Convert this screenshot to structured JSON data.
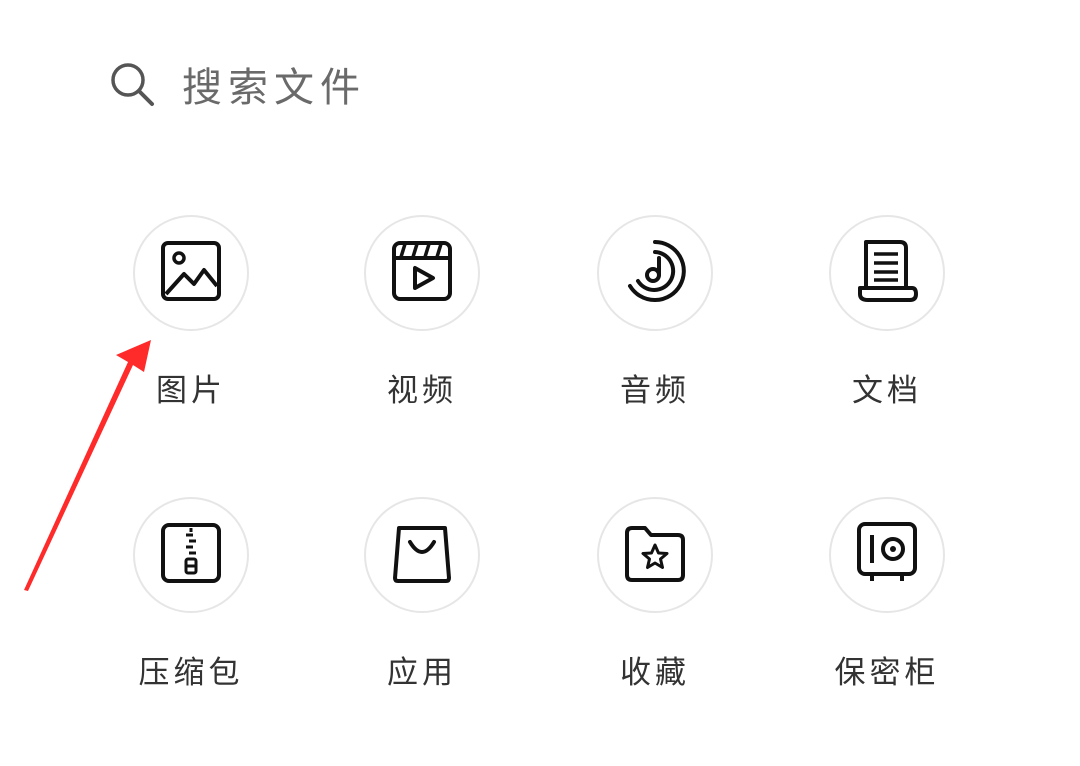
{
  "search": {
    "placeholder": "搜索文件",
    "icon": "search-icon"
  },
  "categories": [
    {
      "label": "图片",
      "icon": "image-icon"
    },
    {
      "label": "视频",
      "icon": "video-icon"
    },
    {
      "label": "音频",
      "icon": "audio-icon"
    },
    {
      "label": "文档",
      "icon": "document-icon"
    },
    {
      "label": "压缩包",
      "icon": "archive-icon"
    },
    {
      "label": "应用",
      "icon": "app-icon"
    },
    {
      "label": "收藏",
      "icon": "favorites-icon"
    },
    {
      "label": "保密柜",
      "icon": "safe-icon"
    }
  ],
  "annotation": {
    "arrow_color": "#ff2a2a",
    "points_to": "图片"
  }
}
